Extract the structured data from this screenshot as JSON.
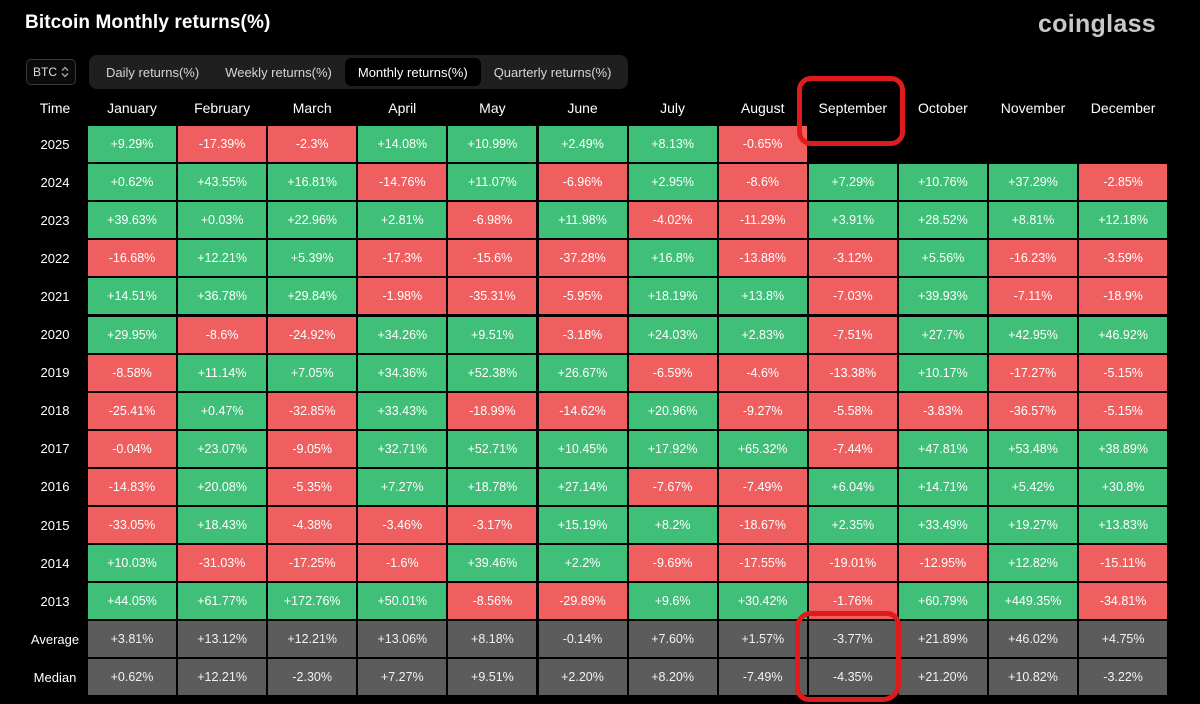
{
  "header": {
    "title": "Bitcoin Monthly returns(%)",
    "brand": "coinglass"
  },
  "controls": {
    "asset": "BTC",
    "tabs": [
      {
        "label": "Daily returns(%)",
        "active": false
      },
      {
        "label": "Weekly returns(%)",
        "active": false
      },
      {
        "label": "Monthly returns(%)",
        "active": true
      },
      {
        "label": "Quarterly returns(%)",
        "active": false
      }
    ]
  },
  "colors": {
    "positive": "#3fbf77",
    "negative": "#ef5f5f",
    "summary": "#5c5c5c",
    "annotation": "#e01b1b"
  },
  "chart_data": {
    "type": "heatmap",
    "title": "Bitcoin Monthly returns(%)",
    "corner_label": "Time",
    "columns": [
      "January",
      "February",
      "March",
      "April",
      "May",
      "June",
      "July",
      "August",
      "September",
      "October",
      "November",
      "December"
    ],
    "rows": [
      {
        "label": "2025",
        "values": [
          "+9.29%",
          "-17.39%",
          "-2.3%",
          "+14.08%",
          "+10.99%",
          "+2.49%",
          "+8.13%",
          "-0.65%",
          null,
          null,
          null,
          null
        ]
      },
      {
        "label": "2024",
        "values": [
          "+0.62%",
          "+43.55%",
          "+16.81%",
          "-14.76%",
          "+11.07%",
          "-6.96%",
          "+2.95%",
          "-8.6%",
          "+7.29%",
          "+10.76%",
          "+37.29%",
          "-2.85%"
        ]
      },
      {
        "label": "2023",
        "values": [
          "+39.63%",
          "+0.03%",
          "+22.96%",
          "+2.81%",
          "-6.98%",
          "+11.98%",
          "-4.02%",
          "-11.29%",
          "+3.91%",
          "+28.52%",
          "+8.81%",
          "+12.18%"
        ]
      },
      {
        "label": "2022",
        "values": [
          "-16.68%",
          "+12.21%",
          "+5.39%",
          "-17.3%",
          "-15.6%",
          "-37.28%",
          "+16.8%",
          "-13.88%",
          "-3.12%",
          "+5.56%",
          "-16.23%",
          "-3.59%"
        ]
      },
      {
        "label": "2021",
        "values": [
          "+14.51%",
          "+36.78%",
          "+29.84%",
          "-1.98%",
          "-35.31%",
          "-5.95%",
          "+18.19%",
          "+13.8%",
          "-7.03%",
          "+39.93%",
          "-7.11%",
          "-18.9%"
        ]
      },
      {
        "label": "2020",
        "values": [
          "+29.95%",
          "-8.6%",
          "-24.92%",
          "+34.26%",
          "+9.51%",
          "-3.18%",
          "+24.03%",
          "+2.83%",
          "-7.51%",
          "+27.7%",
          "+42.95%",
          "+46.92%"
        ]
      },
      {
        "label": "2019",
        "values": [
          "-8.58%",
          "+11.14%",
          "+7.05%",
          "+34.36%",
          "+52.38%",
          "+26.67%",
          "-6.59%",
          "-4.6%",
          "-13.38%",
          "+10.17%",
          "-17.27%",
          "-5.15%"
        ]
      },
      {
        "label": "2018",
        "values": [
          "-25.41%",
          "+0.47%",
          "-32.85%",
          "+33.43%",
          "-18.99%",
          "-14.62%",
          "+20.96%",
          "-9.27%",
          "-5.58%",
          "-3.83%",
          "-36.57%",
          "-5.15%"
        ]
      },
      {
        "label": "2017",
        "values": [
          "-0.04%",
          "+23.07%",
          "-9.05%",
          "+32.71%",
          "+52.71%",
          "+10.45%",
          "+17.92%",
          "+65.32%",
          "-7.44%",
          "+47.81%",
          "+53.48%",
          "+38.89%"
        ]
      },
      {
        "label": "2016",
        "values": [
          "-14.83%",
          "+20.08%",
          "-5.35%",
          "+7.27%",
          "+18.78%",
          "+27.14%",
          "-7.67%",
          "-7.49%",
          "+6.04%",
          "+14.71%",
          "+5.42%",
          "+30.8%"
        ]
      },
      {
        "label": "2015",
        "values": [
          "-33.05%",
          "+18.43%",
          "-4.38%",
          "-3.46%",
          "-3.17%",
          "+15.19%",
          "+8.2%",
          "-18.67%",
          "+2.35%",
          "+33.49%",
          "+19.27%",
          "+13.83%"
        ]
      },
      {
        "label": "2014",
        "values": [
          "+10.03%",
          "-31.03%",
          "-17.25%",
          "-1.6%",
          "+39.46%",
          "+2.2%",
          "-9.69%",
          "-17.55%",
          "-19.01%",
          "-12.95%",
          "+12.82%",
          "-15.11%"
        ]
      },
      {
        "label": "2013",
        "values": [
          "+44.05%",
          "+61.77%",
          "+172.76%",
          "+50.01%",
          "-8.56%",
          "-29.89%",
          "+9.6%",
          "+30.42%",
          "-1.76%",
          "+60.79%",
          "+449.35%",
          "-34.81%"
        ]
      }
    ],
    "summary_rows": [
      {
        "label": "Average",
        "values": [
          "+3.81%",
          "+13.12%",
          "+12.21%",
          "+13.06%",
          "+8.18%",
          "-0.14%",
          "+7.60%",
          "+1.57%",
          "-3.77%",
          "+21.89%",
          "+46.02%",
          "+4.75%"
        ]
      },
      {
        "label": "Median",
        "values": [
          "+0.62%",
          "+12.21%",
          "-2.30%",
          "+7.27%",
          "+9.51%",
          "+2.20%",
          "+8.20%",
          "-7.49%",
          "-4.35%",
          "+21.20%",
          "+10.82%",
          "-3.22%"
        ]
      }
    ]
  }
}
